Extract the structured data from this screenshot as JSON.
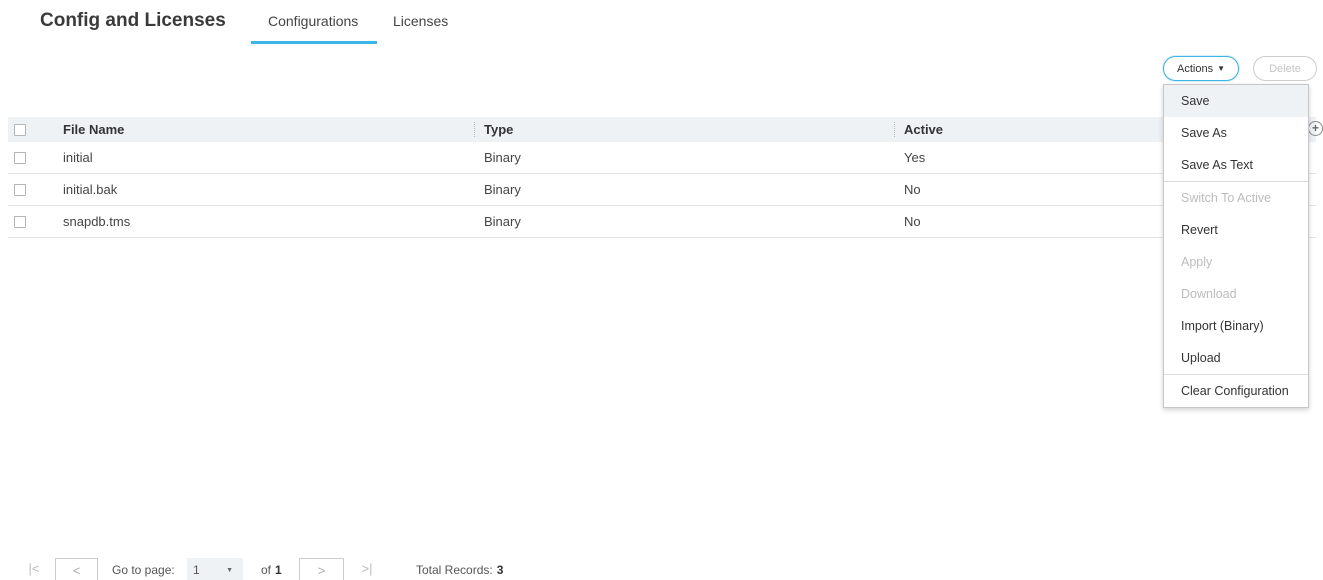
{
  "header": {
    "title": "Config and Licenses",
    "tabs": [
      {
        "label": "Configurations",
        "active": true
      },
      {
        "label": "Licenses",
        "active": false
      }
    ]
  },
  "toolbar": {
    "actions_label": "Actions",
    "delete_label": "Delete"
  },
  "table": {
    "columns": [
      "File Name",
      "Type",
      "Active"
    ],
    "rows": [
      {
        "file_name": "initial",
        "type": "Binary",
        "active": "Yes"
      },
      {
        "file_name": "initial.bak",
        "type": "Binary",
        "active": "No"
      },
      {
        "file_name": "snapdb.tms",
        "type": "Binary",
        "active": "No"
      }
    ]
  },
  "actions_menu": {
    "items": [
      {
        "label": "Save",
        "enabled": true,
        "highlighted": true
      },
      {
        "label": "Save As",
        "enabled": true
      },
      {
        "label": "Save As Text",
        "enabled": true
      },
      {
        "label": "Switch To Active",
        "enabled": false
      },
      {
        "label": "Revert",
        "enabled": true
      },
      {
        "label": "Apply",
        "enabled": false
      },
      {
        "label": "Download",
        "enabled": false
      },
      {
        "label": "Import (Binary)",
        "enabled": true
      },
      {
        "label": "Upload",
        "enabled": true
      },
      {
        "label": "Clear Configuration",
        "enabled": true
      }
    ]
  },
  "pagination": {
    "goto_label": "Go to page:",
    "current_page": "1",
    "of_label": "of",
    "total_pages": "1",
    "total_label": "Total Records:",
    "total_records": "3"
  },
  "colors": {
    "accent": "#3cb4e5",
    "header_bg": "#eef2f5"
  },
  "icons": {
    "first_page": "first-page-icon",
    "prev_page": "chevron-left-icon",
    "next_page": "chevron-right-icon",
    "last_page": "last-page-icon",
    "add_column": "add-circle-icon"
  }
}
